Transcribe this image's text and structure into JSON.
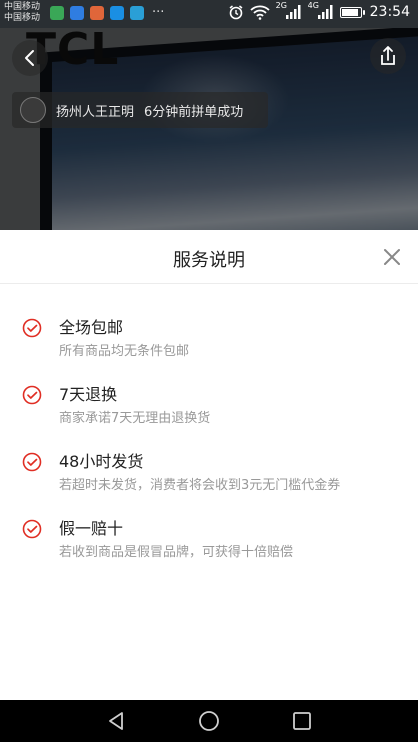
{
  "status_bar": {
    "carrier_1": "中国移动",
    "carrier_2": "中国移动",
    "more": "···",
    "signal_1": "2G",
    "signal_2": "4G",
    "time": "23:54",
    "battery_level": 0.8
  },
  "product": {
    "brand_text": "TCL",
    "group_notice": {
      "user": "扬州人王正明",
      "message": "6分钟前拼单成功"
    }
  },
  "sheet": {
    "title": "服务说明",
    "items": [
      {
        "title": "全场包邮",
        "desc": "所有商品均无条件包邮"
      },
      {
        "title": "7天退换",
        "desc": "商家承诺7天无理由退换货"
      },
      {
        "title": "48小时发货",
        "desc": "若超时未发货，消费者将会收到3元无门槛代金券"
      },
      {
        "title": "假一赔十",
        "desc": "若收到商品是假冒品牌，可获得十倍赔偿"
      }
    ]
  },
  "colors": {
    "accent": "#e02e24",
    "title_text": "#222222",
    "desc_text": "#999999"
  },
  "icons": [
    "back-icon",
    "share-icon",
    "close-icon",
    "check-circle-icon",
    "nav-back-icon",
    "nav-home-icon",
    "nav-recents-icon"
  ]
}
